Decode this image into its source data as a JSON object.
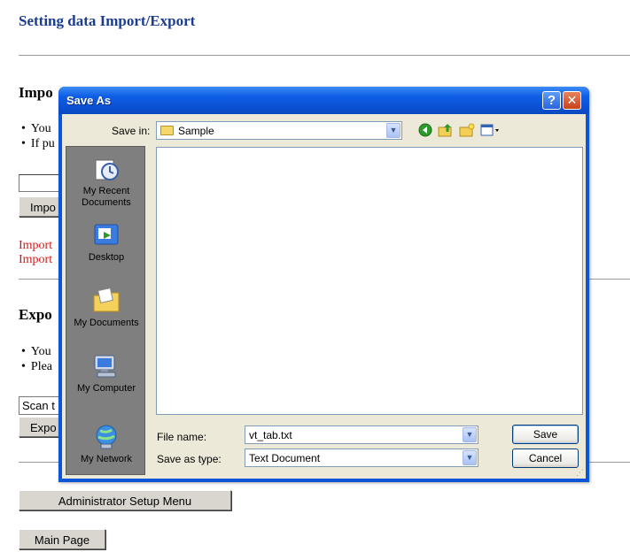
{
  "page": {
    "title": "Setting data Import/Export",
    "import_heading": "Impo",
    "import_bullets": [
      "You",
      "If pu"
    ],
    "import_button": "Impo",
    "import_status": [
      "Import",
      "Import"
    ],
    "export_heading": "Expo",
    "export_bullets": [
      "You",
      "Plea"
    ],
    "export_select": "Scan t",
    "export_button": "Expo",
    "admin_button": "Administrator Setup Menu",
    "main_button": "Main Page"
  },
  "dialog": {
    "title": "Save As",
    "help_glyph": "?",
    "close_glyph": "✕",
    "save_in_label": "Save in:",
    "save_in_value": "Sample",
    "places": [
      {
        "label": "My Recent Documents",
        "icon": "recent-documents-icon"
      },
      {
        "label": "Desktop",
        "icon": "desktop-icon"
      },
      {
        "label": "My Documents",
        "icon": "my-documents-icon"
      },
      {
        "label": "My Computer",
        "icon": "my-computer-icon"
      },
      {
        "label": "My Network",
        "icon": "my-network-icon"
      }
    ],
    "file_name_label": "File name:",
    "file_name_value": "vt_tab.txt",
    "save_as_type_label": "Save as type:",
    "save_as_type_value": "Text Document",
    "save_button": "Save",
    "cancel_button": "Cancel",
    "toolbar_icons": [
      "back-icon",
      "up-folder-icon",
      "new-folder-icon",
      "views-menu-icon"
    ]
  },
  "colors": {
    "title_blue": "#1a3d8f",
    "status_red": "#d21818",
    "dialog_frame": "#0b56d8",
    "dialog_face": "#ece9d8",
    "places_bar": "#7f7f7f"
  }
}
